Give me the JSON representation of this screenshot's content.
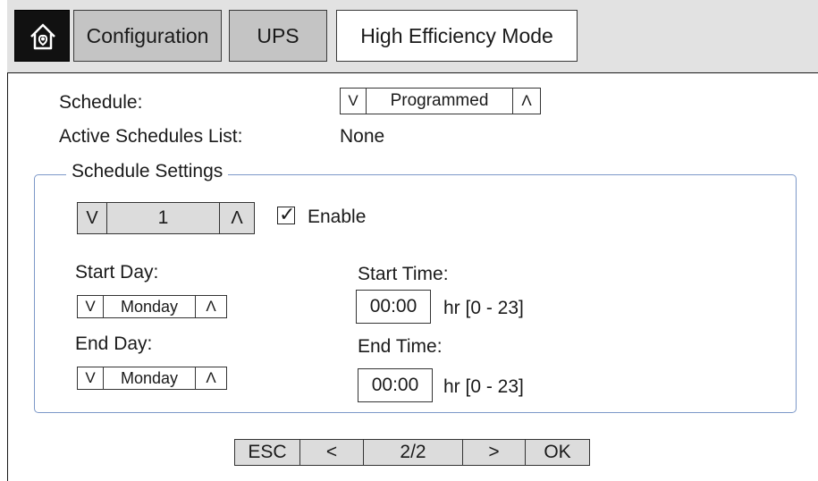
{
  "header": {
    "home_icon": "home-icon",
    "tabs": [
      {
        "label": "Configuration"
      },
      {
        "label": "UPS"
      },
      {
        "label": "High Efficiency Mode"
      }
    ]
  },
  "schedule": {
    "label": "Schedule:",
    "down": "V",
    "value": "Programmed",
    "up": "Λ"
  },
  "active": {
    "label": "Active Schedules List:",
    "value": "None"
  },
  "settings": {
    "legend": "Schedule Settings",
    "index": {
      "down": "V",
      "value": "1",
      "up": "Λ"
    },
    "enable": {
      "label": "Enable",
      "checked": true,
      "check_glyph": "✓"
    },
    "start_day": {
      "label": "Start Day:",
      "down": "V",
      "value": "Monday",
      "up": "Λ"
    },
    "end_day": {
      "label": "End Day:",
      "down": "V",
      "value": "Monday",
      "up": "Λ"
    },
    "start_time": {
      "label": "Start Time:",
      "value": "00:00",
      "unit": "hr [0 - 23]"
    },
    "end_time": {
      "label": "End Time:",
      "value": "00:00",
      "unit": "hr [0 - 23]"
    }
  },
  "footer": {
    "esc": "ESC",
    "prev": "<",
    "page": "2/2",
    "next": ">",
    "ok": "OK"
  }
}
